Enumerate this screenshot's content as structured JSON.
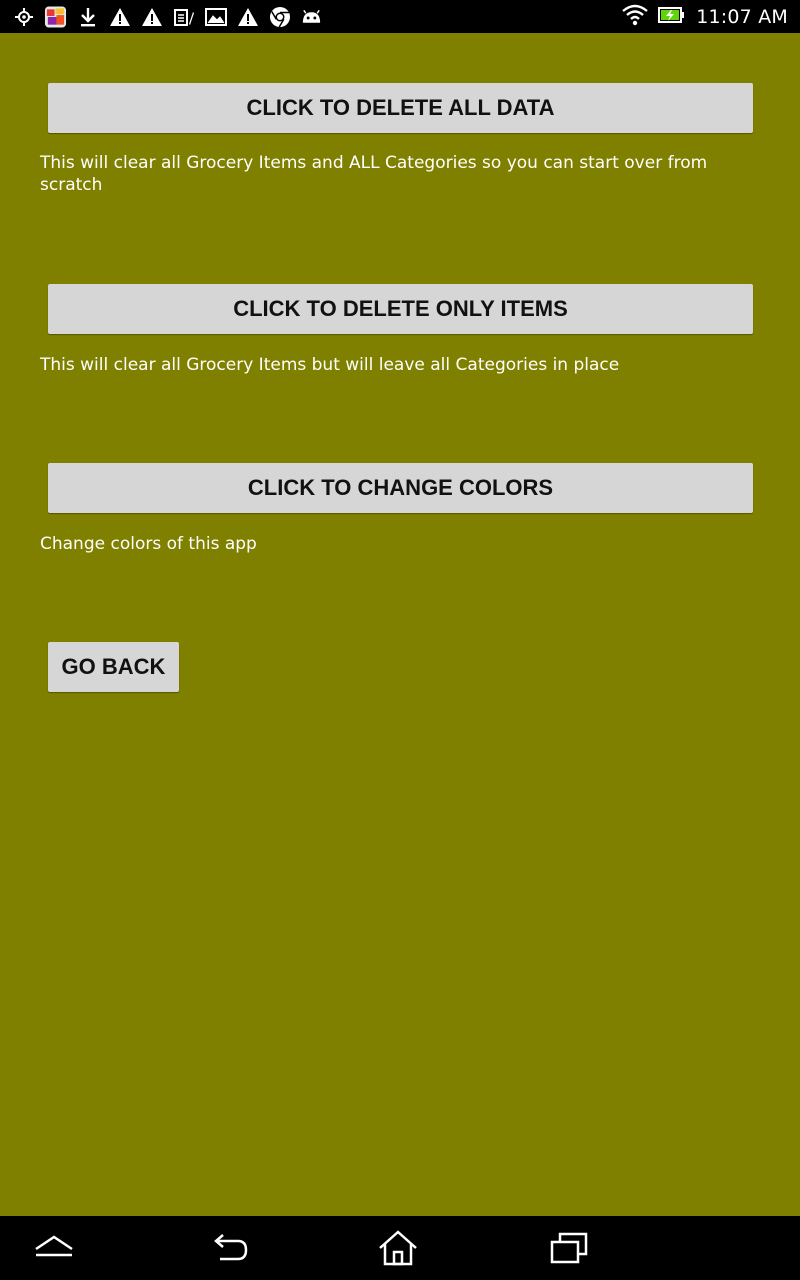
{
  "status_bar": {
    "time": "11:07 AM",
    "left_icons": [
      "gps-icon",
      "app-icon",
      "download-icon",
      "warning-icon",
      "warning-icon",
      "notes-icon",
      "photo-icon",
      "warning-icon",
      "chrome-icon",
      "android-icon"
    ],
    "right_icons": [
      "wifi-icon",
      "battery-charging-icon"
    ]
  },
  "actions": {
    "delete_all": {
      "label": "CLICK TO DELETE ALL DATA",
      "description": "This will clear all Grocery Items and ALL Categories so you can start over from scratch"
    },
    "delete_items": {
      "label": "CLICK TO DELETE ONLY ITEMS",
      "description": "This will clear all Grocery Items but will leave all Categories in place"
    },
    "change_colors": {
      "label": "CLICK TO CHANGE COLORS",
      "description": "Change colors of this app"
    },
    "go_back": {
      "label": "GO BACK"
    }
  },
  "nav_bar": {
    "buttons": [
      "collapse-icon",
      "back-arrow-icon",
      "home-icon",
      "recent-apps-icon"
    ]
  },
  "colors": {
    "background": "#808000",
    "button": "#d6d6d6",
    "bars": "#000000",
    "battery_accent": "#5fd40a"
  }
}
